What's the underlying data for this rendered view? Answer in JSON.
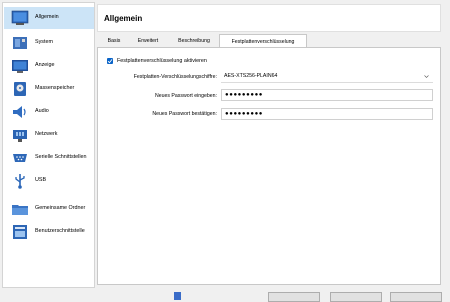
{
  "sidebar": {
    "items": [
      {
        "label": "Allgemein",
        "icon": "general-icon"
      },
      {
        "label": "System",
        "icon": "system-icon"
      },
      {
        "label": "Anzeige",
        "icon": "display-icon"
      },
      {
        "label": "Massenspeicher",
        "icon": "storage-icon"
      },
      {
        "label": "Audio",
        "icon": "audio-icon"
      },
      {
        "label": "Netzwerk",
        "icon": "network-icon"
      },
      {
        "label": "Serielle Schnittstellen",
        "icon": "serial-ports-icon"
      },
      {
        "label": "USB",
        "icon": "usb-icon"
      },
      {
        "label": "Gemeinsame Ordner",
        "icon": "shared-folders-icon"
      },
      {
        "label": "Benutzerschnittstelle",
        "icon": "user-interface-icon"
      }
    ],
    "selected_index": 0
  },
  "header": {
    "title": "Allgemein"
  },
  "tabs": [
    {
      "label": "Basis"
    },
    {
      "label": "Erweitert"
    },
    {
      "label": "Beschreibung"
    },
    {
      "label": "Festplattenverschlüsselung"
    }
  ],
  "active_tab": 3,
  "encryption": {
    "enable_label": "Festplattenverschlüsselung aktivieren",
    "enabled": true,
    "cipher_label": "Festplatten-Verschlüsselungschiffre:",
    "cipher_value": "AES-XTS256-PLAIN64",
    "password_label": "Neues Passwort eingeben:",
    "password_value": "●●●●●●●●●",
    "confirm_label": "Neues Passwort bestätigen:",
    "confirm_value": "●●●●●●●●●"
  },
  "colors": {
    "selection": "#cce4f7",
    "accent": "#0a64c8"
  }
}
